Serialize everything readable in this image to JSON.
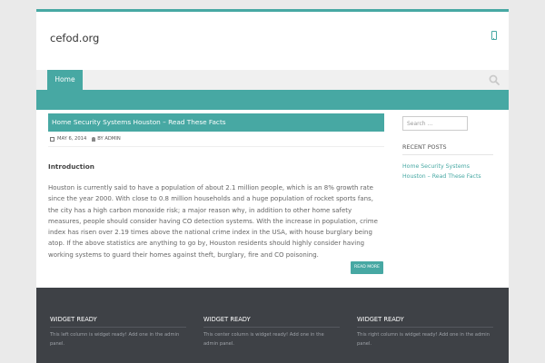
{
  "site": {
    "title": "cefod.org"
  },
  "nav": {
    "items": [
      {
        "label": "Home"
      }
    ]
  },
  "post": {
    "title": "Home Security Systems Houston – Read These Facts",
    "date": "MAY 6, 2014",
    "author": "BY ADMIN",
    "intro_heading": "Introduction",
    "body": "Houston is currently said to have a population of about 2.1 million people, which is an 8% growth rate since the year 2000. With close to 0.8 million households and a huge population of rocket sports fans, the city has a high carbon monoxide risk; a major reason why, in addition to other home safety measures, people should consider having CO detection systems. With the increase in population, crime index has risen over 2.19 times above the national crime index in the USA, with  house burglary being atop. If the above statistics are anything to go by, Houston residents should highly consider having working systems to guard their homes against theft, burglary, fire and CO poisoning.",
    "read_more": "READ MORE"
  },
  "sidebar": {
    "search_placeholder": "Search ...",
    "recent_title": "RECENT POSTS",
    "recent_links": [
      "Home Security Systems",
      "Houston – Read These Facts"
    ]
  },
  "footer": {
    "widgets": [
      {
        "title": "WIDGET READY",
        "text": "This left column is widget ready! Add one in the admin panel."
      },
      {
        "title": "WIDGET READY",
        "text": "This center column is widget ready! Add one in the admin panel."
      },
      {
        "title": "WIDGET READY",
        "text": "This right column is widget ready! Add one in the admin panel."
      }
    ]
  },
  "icons": {
    "mobile": "mobile-phone-icon",
    "search": "search-icon",
    "calendar": "calendar-icon",
    "user": "user-icon"
  },
  "colors": {
    "accent": "#47a8a3",
    "footer_bg": "#3e4146",
    "page_bg": "#eaeaea"
  }
}
